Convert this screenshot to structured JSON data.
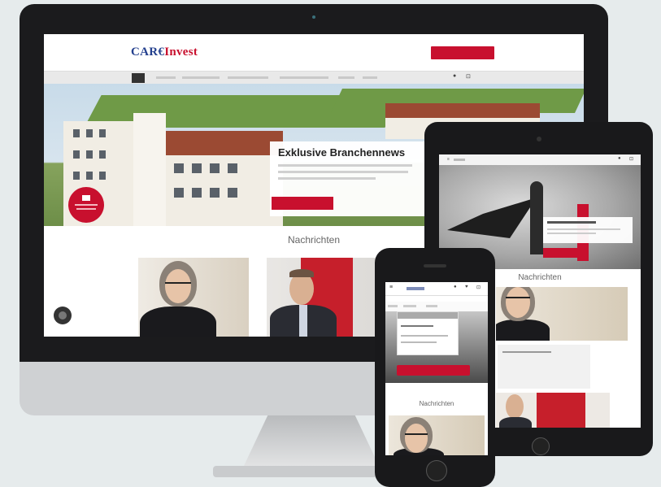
{
  "desktop": {
    "logo": {
      "main": "CAR€",
      "accent": "Invest"
    },
    "nav": {
      "home": ""
    },
    "hero": {
      "title": "Exklusive Branchennews"
    },
    "section_title": "Nachrichten"
  },
  "tablet": {
    "section_title": "Nachrichten"
  },
  "phone": {
    "section_title": "Nachrichten"
  },
  "colors": {
    "brand_red": "#c8102e",
    "brand_blue": "#24408e",
    "device_frame": "#1b1b1d",
    "background": "#e6ebec"
  },
  "icons": [
    "user-icon",
    "cart-icon",
    "menu-icon",
    "heart-icon",
    "chat-icon"
  ]
}
